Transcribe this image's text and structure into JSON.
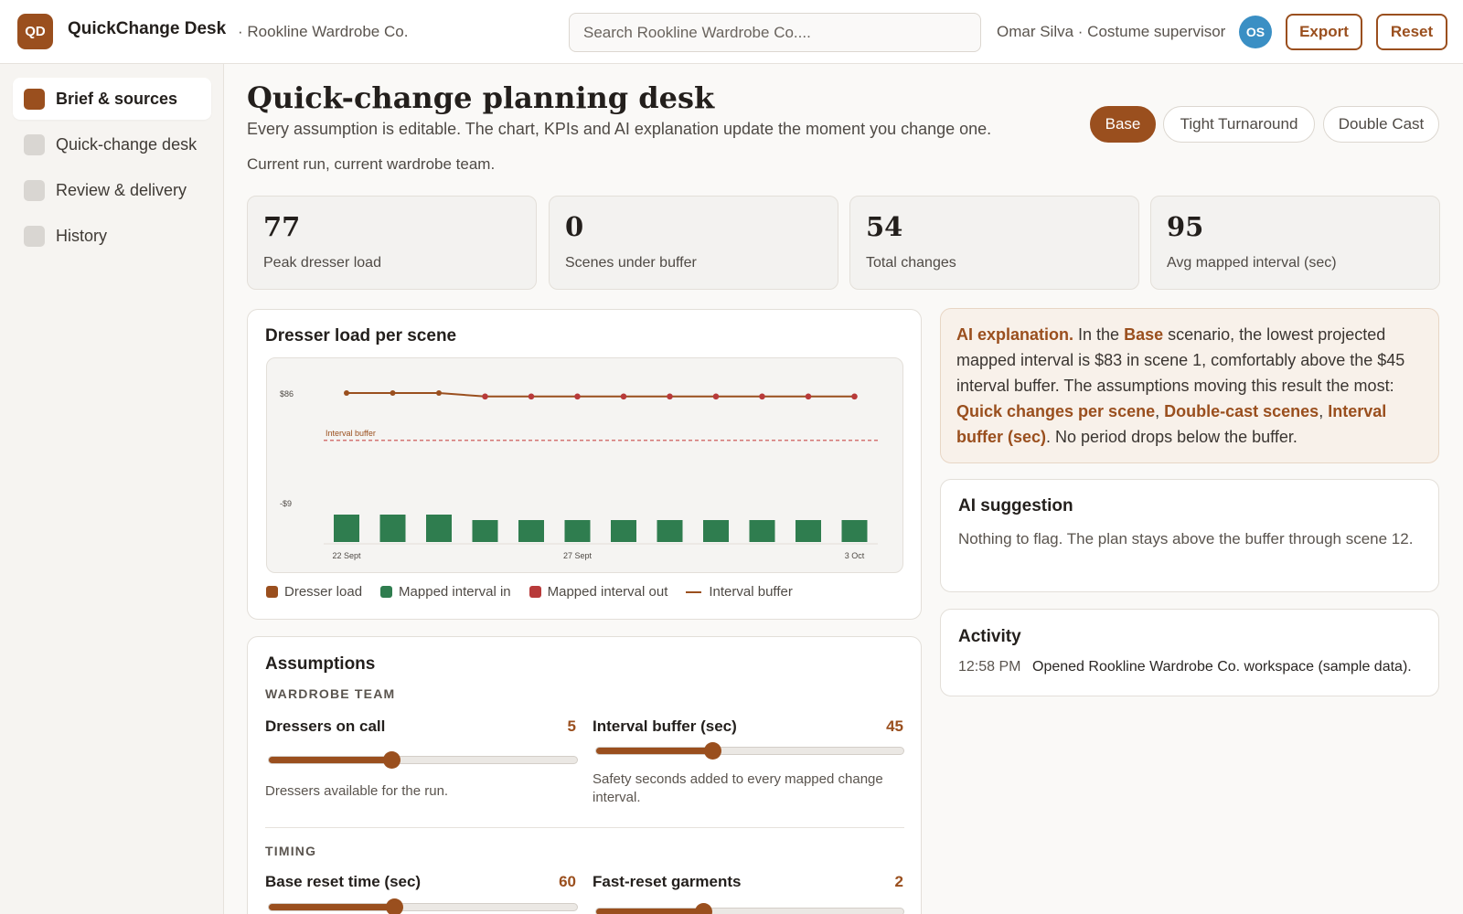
{
  "header": {
    "logo_text": "QD",
    "app_title": "QuickChange Desk",
    "org": "· Rookline Wardrobe Co.",
    "search_placeholder": "Search Rookline Wardrobe Co....",
    "user": "Omar Silva · Costume supervisor",
    "avatar_initials": "OS",
    "export_label": "Export",
    "reset_label": "Reset"
  },
  "sidebar": {
    "items": [
      {
        "label": "Brief & sources",
        "active": true
      },
      {
        "label": "Quick-change desk",
        "active": false
      },
      {
        "label": "Review & delivery",
        "active": false
      },
      {
        "label": "History",
        "active": false
      }
    ]
  },
  "page": {
    "title": "Quick-change planning desk",
    "subtitle": "Every assumption is editable. The chart, KPIs and AI explanation update the moment you change one.",
    "run_info": "Current run, current wardrobe team.",
    "scenarios": [
      {
        "label": "Base",
        "active": true
      },
      {
        "label": "Tight Turnaround",
        "active": false
      },
      {
        "label": "Double Cast",
        "active": false
      }
    ]
  },
  "kpis": [
    {
      "value": "77",
      "label": "Peak dresser load"
    },
    {
      "value": "0",
      "label": "Scenes under buffer"
    },
    {
      "value": "54",
      "label": "Total changes"
    },
    {
      "value": "95",
      "label": "Avg mapped interval (sec)"
    }
  ],
  "chart": {
    "title": "Dresser load per scene",
    "legend": [
      "Dresser load",
      "Mapped interval in",
      "Mapped interval out",
      "Interval buffer"
    ]
  },
  "chart_data": {
    "type": "bar",
    "title": "Dresser load per scene",
    "y_tick_labels": [
      "$86",
      "-$9"
    ],
    "x_tick_labels": [
      "22 Sept",
      "27 Sept",
      "3 Oct"
    ],
    "ylim": [
      -9,
      86
    ],
    "scene_count": 12,
    "series": [
      {
        "name": "Dresser load",
        "kind": "line",
        "color": "#9a4f1e",
        "values": [
          86,
          86,
          86,
          83,
          83,
          83,
          83,
          83,
          83,
          83,
          83,
          83
        ]
      },
      {
        "name": "Mapped interval out",
        "kind": "points",
        "color": "#b83a3a",
        "values": [
          null,
          null,
          null,
          83,
          83,
          83,
          83,
          83,
          83,
          83,
          83,
          83
        ]
      },
      {
        "name": "Mapped interval in",
        "kind": "bar",
        "color": "#2f7d4f",
        "values": [
          -5,
          -5,
          -5,
          -4,
          -4,
          -4,
          -4,
          -4,
          -4,
          -4,
          -4,
          -4
        ]
      }
    ],
    "reference_line": {
      "name": "Interval buffer",
      "label": "Interval buffer",
      "value": 45,
      "color": "#c94b4b",
      "style": "dashed"
    },
    "grid": false,
    "legend_position": "bottom"
  },
  "ai_explanation": {
    "heading": "AI explanation.",
    "t1": " In the ",
    "scenario": "Base",
    "t2": " scenario, the lowest projected mapped interval is $83 in scene 1, comfortably above the $45 interval buffer. The assumptions moving this result the most: ",
    "d1": "Quick changes per scene",
    "sep1": ", ",
    "d2": "Double-cast scenes",
    "sep2": ", ",
    "d3": "Interval buffer (sec)",
    "t3": ". No period drops below the buffer."
  },
  "ai_suggestion": {
    "title": "AI suggestion",
    "text": "Nothing to flag. The plan stays above the buffer through scene 12."
  },
  "activity": {
    "title": "Activity",
    "time": "12:58 PM",
    "text": "Opened Rookline Wardrobe Co. workspace (sample data)."
  },
  "assumptions": {
    "title": "Assumptions",
    "wardrobe_section": "WARDROBE TEAM",
    "timing_section": "TIMING",
    "dressers": {
      "label": "Dressers on call",
      "value": "5",
      "help": "Dressers available for the run.",
      "fraction": 0.4
    },
    "buffer": {
      "label": "Interval buffer (sec)",
      "value": "45",
      "help": "Safety seconds added to every mapped change interval.",
      "fraction": 0.38
    },
    "reset_time": {
      "label": "Base reset time (sec)",
      "value": "60",
      "fraction": 0.41
    },
    "fast_reset": {
      "label": "Fast-reset garments",
      "value": "2",
      "fraction": 0.35
    }
  }
}
